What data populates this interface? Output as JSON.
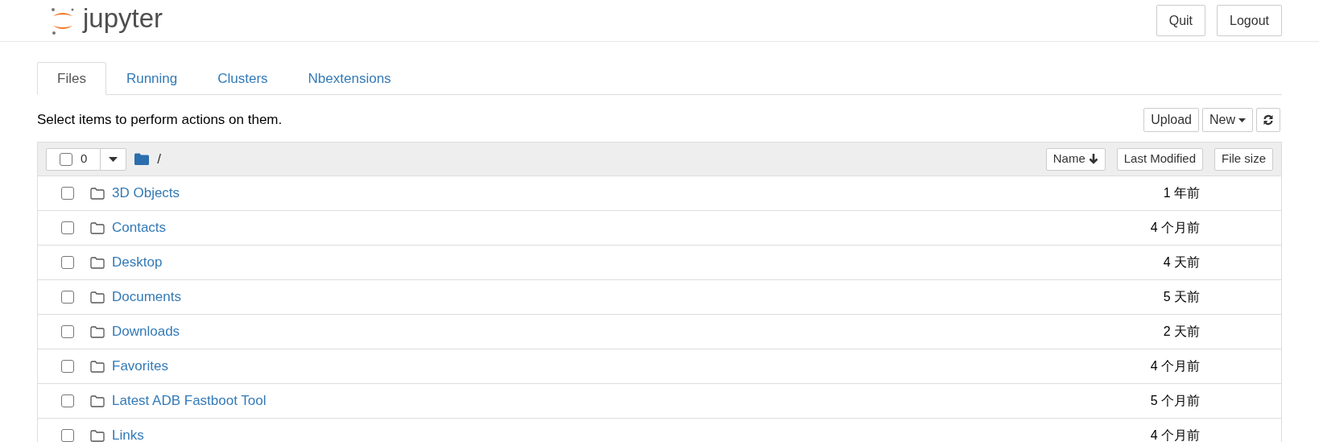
{
  "header": {
    "logo_text": "jupyter",
    "buttons": [
      "Quit",
      "Logout"
    ]
  },
  "tabs": [
    {
      "label": "Files",
      "selected": true
    },
    {
      "label": "Running",
      "selected": false
    },
    {
      "label": "Clusters",
      "selected": false
    },
    {
      "label": "Nbextensions",
      "selected": false
    }
  ],
  "instructions": "Select items to perform actions on them.",
  "actions": {
    "upload": "Upload",
    "new": "New"
  },
  "list_header": {
    "select_all_checked": false,
    "selected_count": "0",
    "path": "/",
    "sort_buttons": [
      "Name",
      "Last Modified",
      "File size"
    ]
  },
  "rows": [
    {
      "name": "3D Objects",
      "modified": "1 年前",
      "checked": false
    },
    {
      "name": "Contacts",
      "modified": "4 个月前",
      "checked": false
    },
    {
      "name": "Desktop",
      "modified": "4 天前",
      "checked": false
    },
    {
      "name": "Documents",
      "modified": "5 天前",
      "checked": false
    },
    {
      "name": "Downloads",
      "modified": "2 天前",
      "checked": false
    },
    {
      "name": "Favorites",
      "modified": "4 个月前",
      "checked": false
    },
    {
      "name": "Latest ADB Fastboot Tool",
      "modified": "5 个月前",
      "checked": false
    },
    {
      "name": "Links",
      "modified": "4 个月前",
      "checked": false
    }
  ]
}
